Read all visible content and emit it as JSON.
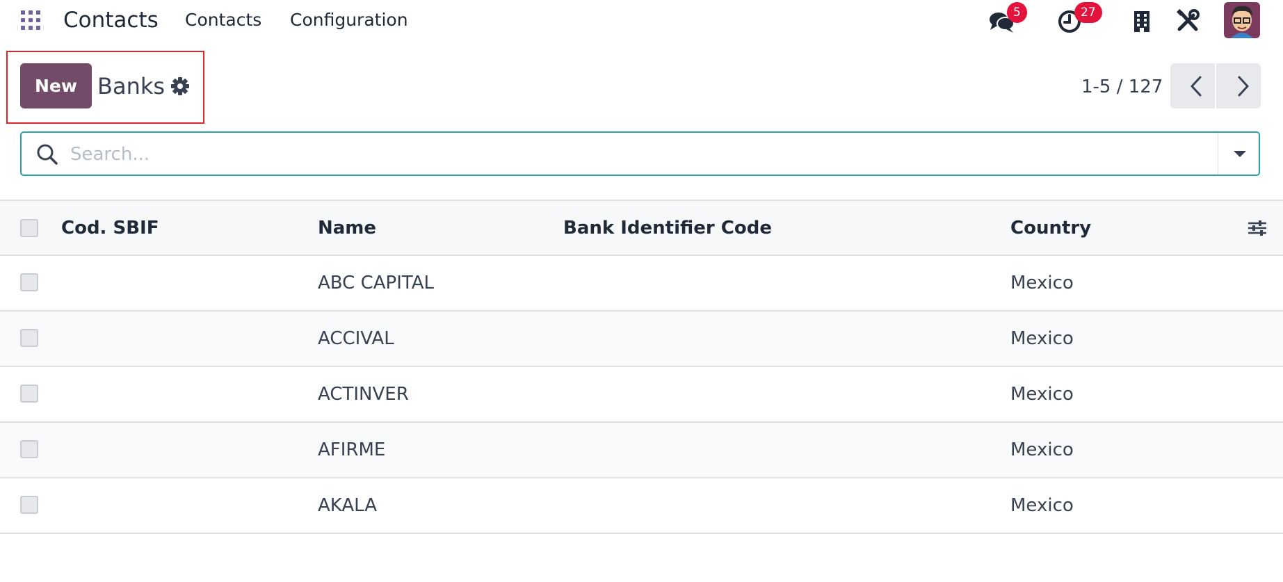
{
  "navbar": {
    "app_name": "Contacts",
    "menu": [
      "Contacts",
      "Configuration"
    ],
    "messages_badge": "5",
    "activities_badge": "27"
  },
  "control_panel": {
    "new_label": "New",
    "title": "Banks",
    "pager": "1-5 / 127"
  },
  "search": {
    "placeholder": "Search..."
  },
  "table": {
    "headers": [
      "Cod. SBIF",
      "Name",
      "Bank Identifier Code",
      "Country"
    ],
    "rows": [
      {
        "code": "",
        "name": "ABC CAPITAL",
        "bic": "",
        "country": "Mexico"
      },
      {
        "code": "",
        "name": "ACCIVAL",
        "bic": "",
        "country": "Mexico"
      },
      {
        "code": "",
        "name": "ACTINVER",
        "bic": "",
        "country": "Mexico"
      },
      {
        "code": "",
        "name": "AFIRME",
        "bic": "",
        "country": "Mexico"
      },
      {
        "code": "",
        "name": "AKALA",
        "bic": "",
        "country": "Mexico"
      }
    ]
  },
  "colors": {
    "brand": "#714b67",
    "badge": "#e2143c",
    "search_border": "#27a3a3",
    "highlight": "#e0242a"
  },
  "icons": [
    "apps-grid-icon",
    "chat-icon",
    "clock-icon",
    "building-icon",
    "tools-icon",
    "user-avatar",
    "gear-icon",
    "chevron-left-icon",
    "chevron-right-icon",
    "search-icon",
    "caret-down-icon",
    "column-settings-icon"
  ]
}
